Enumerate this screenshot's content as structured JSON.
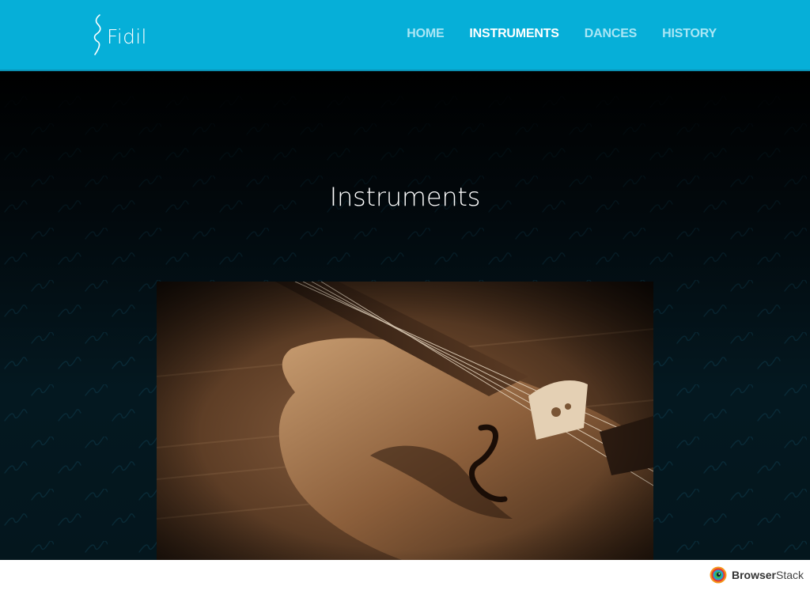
{
  "header": {
    "logo_text": "Fidil",
    "background": "#06afd8",
    "nav": [
      {
        "label": "HOME",
        "active": false
      },
      {
        "label": "INSTRUMENTS",
        "active": true
      },
      {
        "label": "DANCES",
        "active": false
      },
      {
        "label": "HISTORY",
        "active": false
      }
    ]
  },
  "main": {
    "title": "Instruments",
    "hero_image": "violin-photo"
  },
  "footer": {
    "badge_brand": "Browser",
    "badge_suffix": "Stack"
  }
}
